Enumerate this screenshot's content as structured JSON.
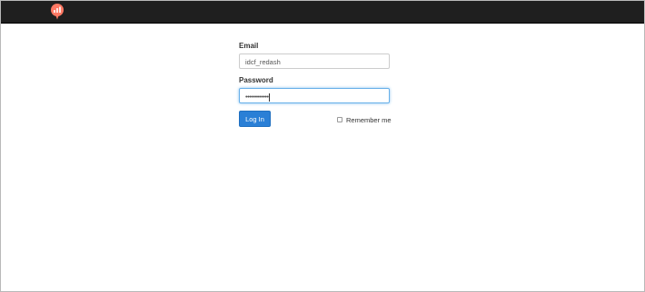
{
  "navbar": {
    "logo_icon": "redash-logo-icon",
    "logo_color": "#ff7964",
    "background": "#1f1f1f"
  },
  "login_form": {
    "email_label": "Email",
    "email_value": "idcf_redash",
    "password_label": "Password",
    "password_value": "••••••••••••",
    "login_button_label": "Log In",
    "remember_label": "Remember me",
    "remember_checked": false,
    "button_color": "#2a7fd6"
  }
}
